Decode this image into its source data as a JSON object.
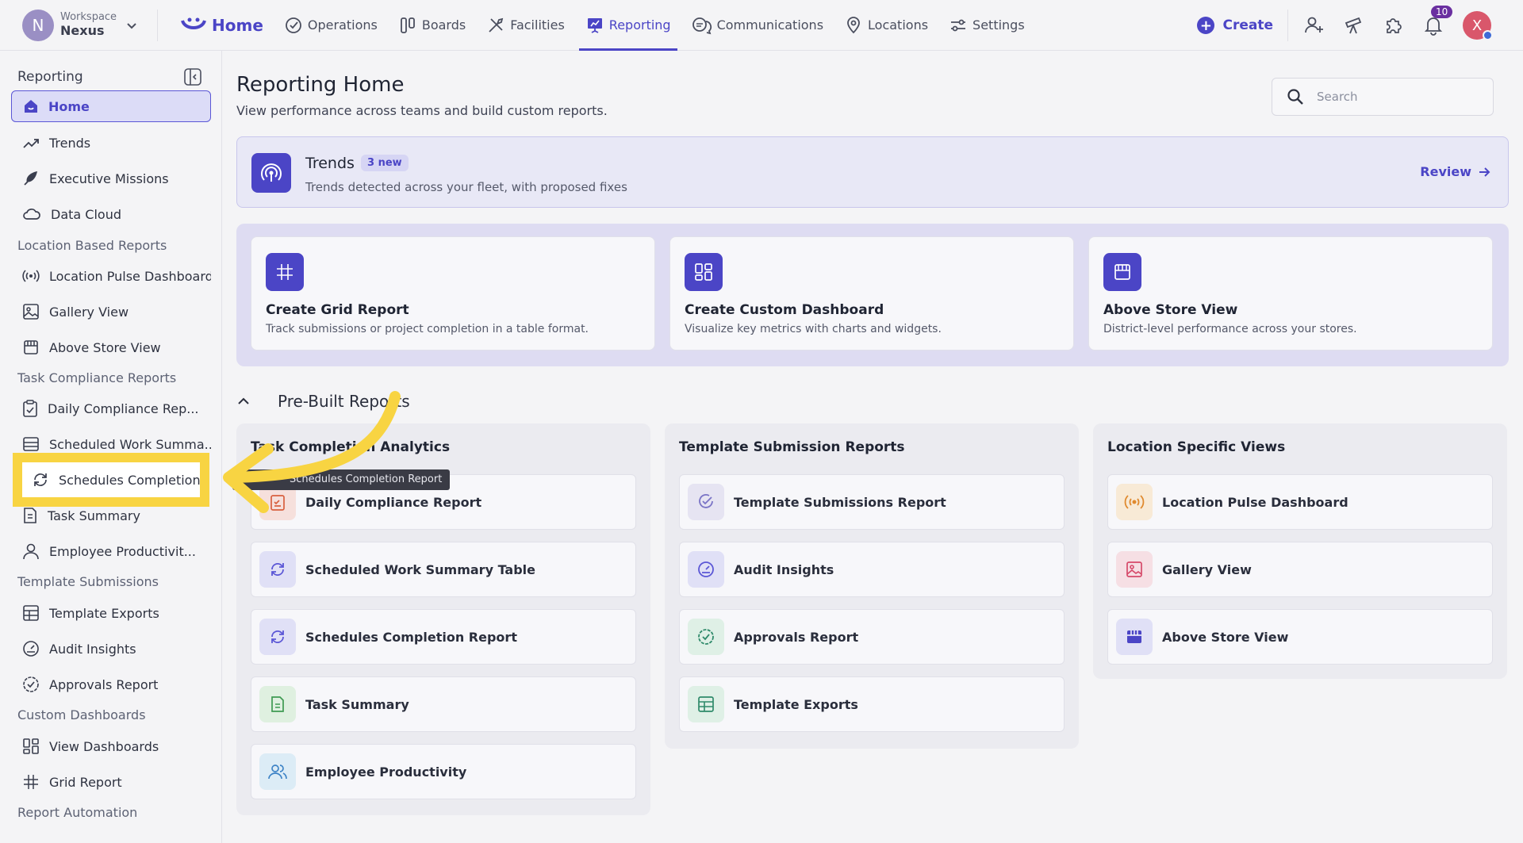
{
  "workspace": {
    "label": "Workspace",
    "name": "Nexus",
    "avatar_letter": "N"
  },
  "nav": {
    "home": "Home",
    "items": [
      "Operations",
      "Boards",
      "Facilities",
      "Reporting",
      "Communications",
      "Locations",
      "Settings"
    ],
    "active": "Reporting"
  },
  "top_right": {
    "create": "Create",
    "notification_count": "10",
    "user_initial": "X"
  },
  "sidebar": {
    "title": "Reporting",
    "items": {
      "home": "Home",
      "trends": "Trends",
      "executive_missions": "Executive Missions",
      "data_cloud": "Data Cloud",
      "location_pulse": "Location Pulse Dashboard",
      "gallery_view": "Gallery View",
      "above_store": "Above Store View",
      "daily_compliance": "Daily Compliance Rep...",
      "scheduled_work": "Scheduled Work Summa...",
      "schedules_completion": "Schedules Completion...",
      "task_summary": "Task Summary",
      "employee_productivity": "Employee Productivit...",
      "template_exports": "Template Exports",
      "audit_insights": "Audit Insights",
      "approvals_report": "Approvals Report",
      "view_dashboards": "View Dashboards",
      "grid_report": "Grid Report"
    },
    "sections": {
      "location_based": "Location Based Reports",
      "task_compliance": "Task Compliance Reports",
      "template_submissions": "Template Submissions",
      "custom_dashboards": "Custom Dashboards",
      "report_automation": "Report Automation"
    }
  },
  "main": {
    "title": "Reporting Home",
    "subtitle": "View performance across teams and build custom reports.",
    "search_placeholder": "Search",
    "trends": {
      "title": "Trends",
      "badge": "3 new",
      "desc": "Trends detected across your fleet, with proposed fixes",
      "review": "Review"
    },
    "create_cards": [
      {
        "title": "Create Grid Report",
        "desc": "Track submissions or project completion in a table format."
      },
      {
        "title": "Create Custom Dashboard",
        "desc": "Visualize key metrics with charts and widgets."
      },
      {
        "title": "Above Store View",
        "desc": "District-level performance across your stores."
      }
    ],
    "prebuilt_title": "Pre-Built Reports",
    "columns": [
      {
        "title": "Task Completion Analytics",
        "rows": [
          "Daily Compliance Report",
          "Scheduled Work Summary Table",
          "Schedules Completion Report",
          "Task Summary",
          "Employee Productivity"
        ]
      },
      {
        "title": "Template Submission Reports",
        "rows": [
          "Template Submissions Report",
          "Audit Insights",
          "Approvals Report",
          "Template Exports"
        ]
      },
      {
        "title": "Location Specific Views",
        "rows": [
          "Location Pulse Dashboard",
          "Gallery View",
          "Above Store View"
        ]
      }
    ],
    "tooltip": "Schedules Completion Report"
  },
  "colors": {
    "accent": "#4b45c6",
    "highlight": "#f8d442"
  }
}
